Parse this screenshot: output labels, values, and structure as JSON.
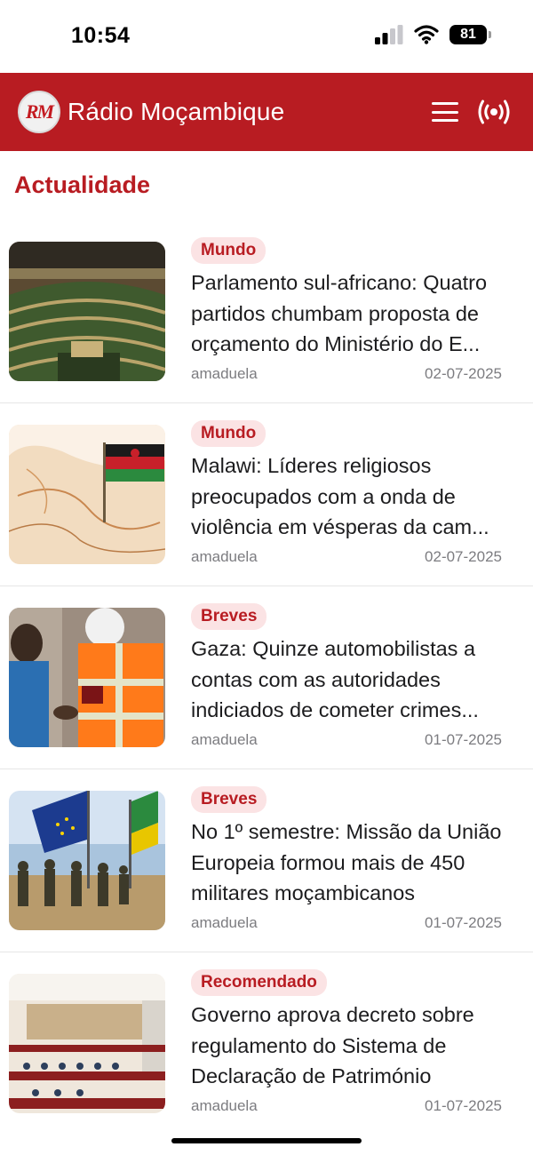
{
  "status": {
    "time": "10:54",
    "battery": "81"
  },
  "header": {
    "logo_text": "RM",
    "title": "Rádio Moçambique"
  },
  "section": {
    "title": "Actualidade"
  },
  "articles": [
    {
      "category": "Mundo",
      "title": "Parlamento sul-africano: Quatro partidos chumbam proposta de orçamento do Ministério do E...",
      "author": "amaduela",
      "date": "02-07-2025",
      "image": "parliament-chamber"
    },
    {
      "category": "Mundo",
      "title": "Malawi: Líderes religiosos preocupados com a onda de violência em vésperas da cam...",
      "author": "amaduela",
      "date": "02-07-2025",
      "image": "malawi-flag-on-map"
    },
    {
      "category": "Breves",
      "title": "Gaza: Quinze automobilistas a contas com as autoridades indiciados de cometer crimes...",
      "author": "amaduela",
      "date": "01-07-2025",
      "image": "traffic-officers"
    },
    {
      "category": "Breves",
      "title": "No 1º semestre: Missão da União Europeia formou mais de 450 militares moçambicanos",
      "author": "amaduela",
      "date": "01-07-2025",
      "image": "soldiers-eu-flag"
    },
    {
      "category": "Recomendado",
      "title": "Governo aprova decreto sobre regulamento do Sistema de Declaração de Património",
      "author": "amaduela",
      "date": "01-07-2025",
      "image": "council-meeting"
    }
  ],
  "colors": {
    "brand": "#b81c22",
    "badge_bg": "#fbe3e4"
  }
}
